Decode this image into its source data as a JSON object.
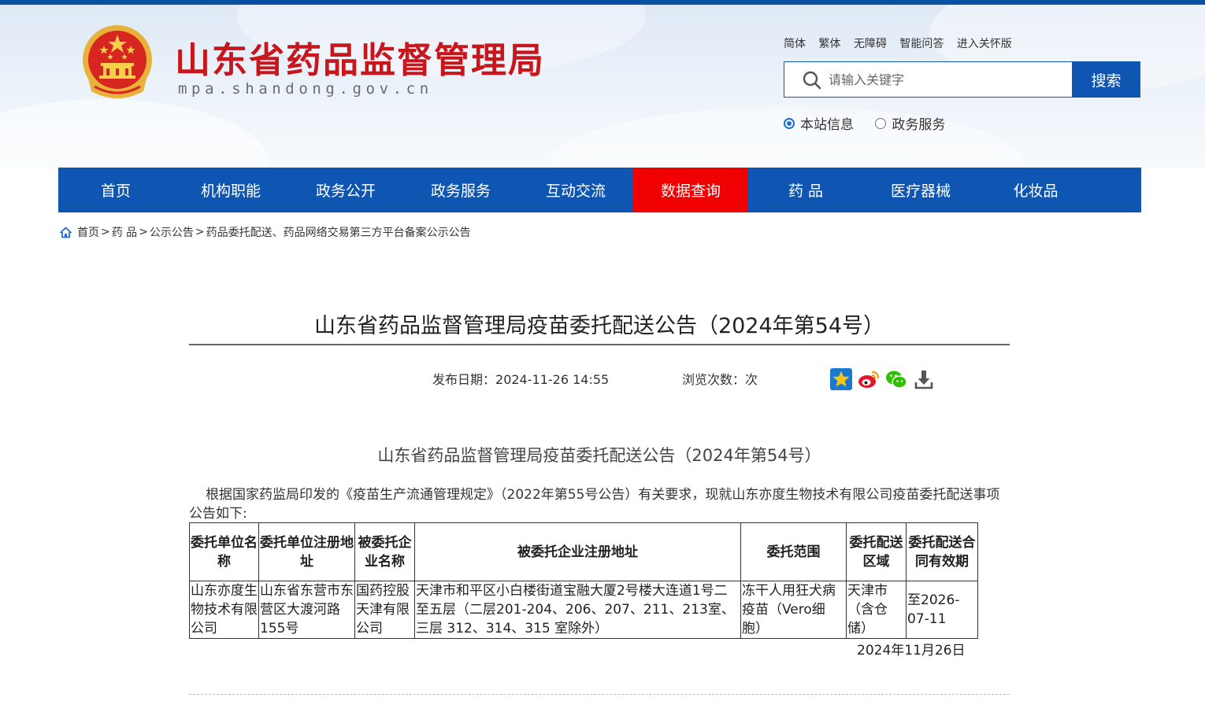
{
  "site": {
    "title": "山东省药品监督管理局",
    "domain": "mpa.shandong.gov.cn"
  },
  "top_links": [
    "简体",
    "繁体",
    "无障碍",
    "智能问答",
    "进入关怀版"
  ],
  "search": {
    "placeholder": "请输入关键字",
    "button_label": "搜索",
    "scope_options": [
      {
        "label": "本站信息",
        "selected": true
      },
      {
        "label": "政务服务",
        "selected": false
      }
    ]
  },
  "nav": {
    "items": [
      "首页",
      "机构职能",
      "政务公开",
      "政务服务",
      "互动交流",
      "数据查询",
      "药 品",
      "医疗器械",
      "化妆品"
    ],
    "active_index": 5
  },
  "breadcrumb": {
    "items": [
      "首页",
      "药 品",
      "公示公告",
      "药品委托配送、药品网络交易第三方平台备案公示公告"
    ],
    "separator": ">"
  },
  "article": {
    "title": "山东省药品监督管理局疫苗委托配送公告（2024年第54号）",
    "publish_date_label": "发布日期：",
    "publish_date": "2024-11-26 14:55",
    "views_label": "浏览次数：",
    "views_suffix": "次",
    "share_icons": [
      "star-share-icon",
      "weibo-icon",
      "wechat-icon",
      "download-icon"
    ],
    "inner_title": "山东省药品监督管理局疫苗委托配送公告（2024年第54号）",
    "intro": "根据国家药监局印发的《疫苗生产流通管理规定》（2022年第55号公告）有关要求，现就山东亦度生物技术有限公司疫苗委托配送事项公告如下:",
    "table": {
      "headers": [
        "委托单位名称",
        "委托单位注册地址",
        "被委托企业名称",
        "被委托企业注册地址",
        "委托范围",
        "委托配送区域",
        "委托配送合同有效期"
      ],
      "rows": [
        [
          "山东亦度生物技术有限公司",
          "山东省东营市东营区大渡河路155号",
          "国药控股天津有限公司",
          "天津市和平区小白楼街道宝融大厦2号楼大连道1号二至五层（二层201-204、206、207、211、213室、三层 312、314、315 室除外）",
          "冻干人用狂犬病疫苗（Vero细胞）",
          "天津市（含仓储）",
          "至2026-07-11"
        ]
      ]
    },
    "sign_date": "2024年11月26日"
  },
  "colors": {
    "nav_blue": "#0e56b1",
    "active_red": "#f00000",
    "title_red": "#c8161d",
    "top_bar": "#0b4fa3"
  }
}
